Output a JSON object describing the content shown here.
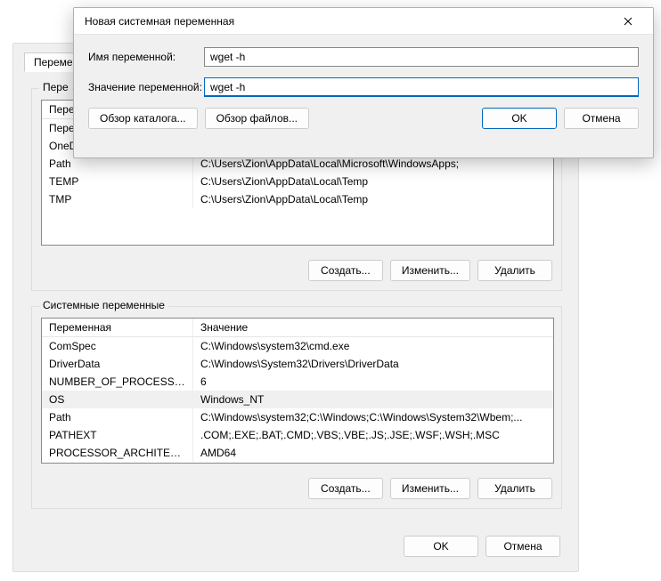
{
  "parent": {
    "tab_label": "Переменн",
    "user_group_title": "Пере",
    "sys_group_title": "Системные переменные",
    "col_name": "Переменная",
    "col_value": "Значение",
    "user_vars": [
      {
        "name": "Пере",
        "value": ""
      },
      {
        "name": "OneD",
        "value": ""
      },
      {
        "name": "Path",
        "value": "C:\\Users\\Zion\\AppData\\Local\\Microsoft\\WindowsApps;"
      },
      {
        "name": "TEMP",
        "value": "C:\\Users\\Zion\\AppData\\Local\\Temp"
      },
      {
        "name": "TMP",
        "value": "C:\\Users\\Zion\\AppData\\Local\\Temp"
      }
    ],
    "sys_vars": [
      {
        "name": "ComSpec",
        "value": "C:\\Windows\\system32\\cmd.exe",
        "selected": false
      },
      {
        "name": "DriverData",
        "value": "C:\\Windows\\System32\\Drivers\\DriverData",
        "selected": false
      },
      {
        "name": "NUMBER_OF_PROCESSORS",
        "value": "6",
        "selected": false
      },
      {
        "name": "OS",
        "value": "Windows_NT",
        "selected": true
      },
      {
        "name": "Path",
        "value": "C:\\Windows\\system32;C:\\Windows;C:\\Windows\\System32\\Wbem;...",
        "selected": false
      },
      {
        "name": "PATHEXT",
        "value": ".COM;.EXE;.BAT;.CMD;.VBS;.VBE;.JS;.JSE;.WSF;.WSH;.MSC",
        "selected": false
      },
      {
        "name": "PROCESSOR_ARCHITECTURE",
        "value": "AMD64",
        "selected": false
      }
    ],
    "buttons": {
      "create": "Создать...",
      "edit": "Изменить...",
      "delete": "Удалить",
      "ok": "OK",
      "cancel": "Отмена"
    }
  },
  "modal": {
    "title": "Новая системная переменная",
    "name_label": "Имя переменной:",
    "value_label": "Значение переменной:",
    "name_value": "wget -h",
    "value_value": "wget -h",
    "browse_dir": "Обзор каталога...",
    "browse_file": "Обзор файлов...",
    "ok": "OK",
    "cancel": "Отмена"
  }
}
